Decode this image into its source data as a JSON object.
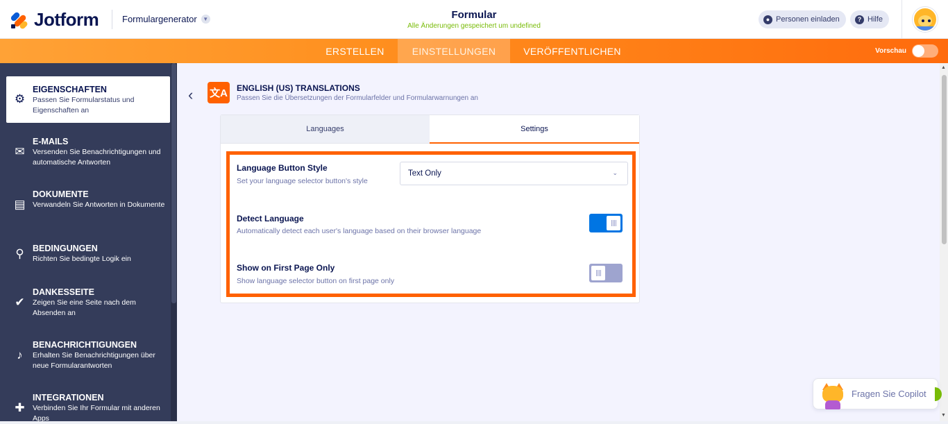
{
  "header": {
    "brand": "Jotform",
    "builder_title": "Formulargenerator",
    "form_title": "Formular",
    "save_status": "Alle Änderungen gespeichert um undefined",
    "invite_label": "Personen einladen",
    "help_label": "Hilfe"
  },
  "nav": {
    "tabs": [
      "ERSTELLEN",
      "EINSTELLUNGEN",
      "VERÖFFENTLICHEN"
    ],
    "active_tab": "EINSTELLUNGEN",
    "preview_label": "Vorschau",
    "preview_enabled": false
  },
  "sidebar": {
    "items": [
      {
        "title": "EIGENSCHAFTEN",
        "desc": "Passen Sie Formularstatus und Eigenschaften an",
        "icon": "gear-icon",
        "active": true
      },
      {
        "title": "E-MAILS",
        "desc": "Versenden Sie Benachrichtigungen und automatische Antworten",
        "icon": "envelope-icon"
      },
      {
        "title": "DOKUMENTE",
        "desc": "Verwandeln Sie Antworten in Dokumente",
        "icon": "document-icon"
      },
      {
        "title": "BEDINGUNGEN",
        "desc": "Richten Sie bedingte Logik ein",
        "icon": "hierarchy-icon"
      },
      {
        "title": "DANKESSEITE",
        "desc": "Zeigen Sie eine Seite nach dem Absenden an",
        "icon": "check-circle-icon"
      },
      {
        "title": "BENACHRICHTIGUNGEN",
        "desc": "Erhalten Sie Benachrichtigungen über neue Formularantworten",
        "icon": "bell-icon"
      },
      {
        "title": "INTEGRATIONEN",
        "desc": "Verbinden Sie Ihr Formular mit anderen Apps",
        "icon": "puzzle-icon"
      }
    ]
  },
  "page": {
    "title": "ENGLISH (US) TRANSLATIONS",
    "subtitle": "Passen Sie die Übersetzungen der Formularfelder und Formularwarnungen an",
    "tabs": {
      "languages": "Languages",
      "settings": "Settings"
    },
    "active_tab": "Settings"
  },
  "settings": {
    "button_style": {
      "label": "Language Button Style",
      "desc": "Set your language selector button's style",
      "value": "Text Only"
    },
    "detect_language": {
      "label": "Detect Language",
      "desc": "Automatically detect each user's language based on their browser language",
      "enabled": true
    },
    "first_page_only": {
      "label": "Show on First Page Only",
      "desc": "Show language selector button on first page only",
      "enabled": false
    }
  },
  "copilot": {
    "label": "Fragen Sie Copilot"
  },
  "colors": {
    "accent": "#ff6100",
    "sidebar_bg": "#343c5a",
    "toggle_on": "#0075e3",
    "toggle_off": "#9ea4cf",
    "status_green": "#78bb07"
  }
}
